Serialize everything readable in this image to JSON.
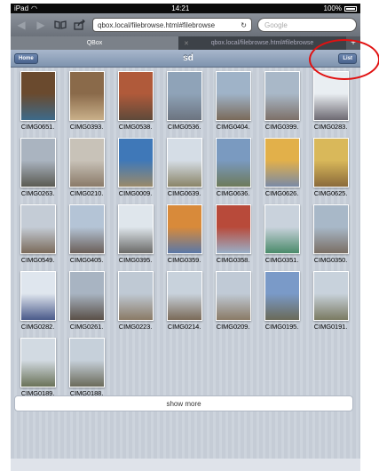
{
  "status": {
    "carrier": "iPad",
    "time": "14:21",
    "battery": "100%"
  },
  "toolbar": {
    "url": "qbox.local/filebrowse.html#filebrowse",
    "search_placeholder": "Google"
  },
  "tabs": [
    {
      "label": "QBox",
      "active": true
    },
    {
      "label": "qbox.local/filebrowse.html#filebrowse",
      "active": false
    }
  ],
  "nav": {
    "home_label": "Home",
    "title": "sd",
    "list_label": "List"
  },
  "photos": [
    {
      "name": "CIMG0651.",
      "colors": [
        "#6a4a2e",
        "#3d6a8a"
      ]
    },
    {
      "name": "CIMG0393.",
      "colors": [
        "#8a6a4a",
        "#c9b08a"
      ]
    },
    {
      "name": "CIMG0538.",
      "colors": [
        "#b05a3a",
        "#5f4a3a"
      ]
    },
    {
      "name": "CIMG0536.",
      "colors": [
        "#8fa3b8",
        "#6c7480"
      ]
    },
    {
      "name": "CIMG0404.",
      "colors": [
        "#9fb3c8",
        "#7a6a5a"
      ]
    },
    {
      "name": "CIMG0399.",
      "colors": [
        "#a9b8c8",
        "#7d7068"
      ]
    },
    {
      "name": "CIMG0283.",
      "colors": [
        "#e9eef2",
        "#6d6a72"
      ]
    },
    {
      "name": "CIMG0263.",
      "colors": [
        "#aab4c0",
        "#5a5a52"
      ]
    },
    {
      "name": "CIMG0210.",
      "colors": [
        "#c8c2b8",
        "#8a7a68"
      ]
    },
    {
      "name": "CIMG0009.",
      "colors": [
        "#3f78b8",
        "#9a8a6a"
      ]
    },
    {
      "name": "CIMG0639.",
      "colors": [
        "#d5dde6",
        "#8a8468"
      ]
    },
    {
      "name": "CIMG0636.",
      "colors": [
        "#7a9ac0",
        "#6d7a5a"
      ]
    },
    {
      "name": "CIMG0626.",
      "colors": [
        "#e2b04a",
        "#7a8aa6"
      ]
    },
    {
      "name": "CIMG0625.",
      "colors": [
        "#d9b85a",
        "#8a6a3a"
      ]
    },
    {
      "name": "CIMG0549.",
      "colors": [
        "#c4ccd6",
        "#7a6a5a"
      ]
    },
    {
      "name": "CIMG0405.",
      "colors": [
        "#b4c4d6",
        "#6a5e58"
      ]
    },
    {
      "name": "CIMG0395.",
      "colors": [
        "#dfe6ec",
        "#6a6a68"
      ]
    },
    {
      "name": "CIMG0359.",
      "colors": [
        "#d88a3a",
        "#5a78a8"
      ]
    },
    {
      "name": "CIMG0358.",
      "colors": [
        "#b84a3a",
        "#9ab0c8"
      ]
    },
    {
      "name": "CIMG0351.",
      "colors": [
        "#c9d2dc",
        "#4a8a6a"
      ]
    },
    {
      "name": "CIMG0350.",
      "colors": [
        "#a8b8c8",
        "#7a6e64"
      ]
    },
    {
      "name": "CIMG0282.",
      "colors": [
        "#dfe6ee",
        "#4a5a8a"
      ]
    },
    {
      "name": "CIMG0261.",
      "colors": [
        "#a8b4c2",
        "#5a5048"
      ]
    },
    {
      "name": "CIMG0223.",
      "colors": [
        "#bfc9d4",
        "#8a7a66"
      ]
    },
    {
      "name": "CIMG0214.",
      "colors": [
        "#c8d2dc",
        "#7a6a58"
      ]
    },
    {
      "name": "CIMG0209.",
      "colors": [
        "#c0cad6",
        "#8a7a66"
      ]
    },
    {
      "name": "CIMG0195.",
      "colors": [
        "#7a9ac8",
        "#6a6a58"
      ]
    },
    {
      "name": "CIMG0191.",
      "colors": [
        "#c8d2dc",
        "#7a7a62"
      ]
    },
    {
      "name": "CIMG0189.",
      "colors": [
        "#d2dae2",
        "#6a7258"
      ]
    },
    {
      "name": "CIMG0188.",
      "colors": [
        "#c6d0da",
        "#6a6a5a"
      ]
    }
  ],
  "show_more_label": "show more",
  "annotation_color": "#e11111"
}
